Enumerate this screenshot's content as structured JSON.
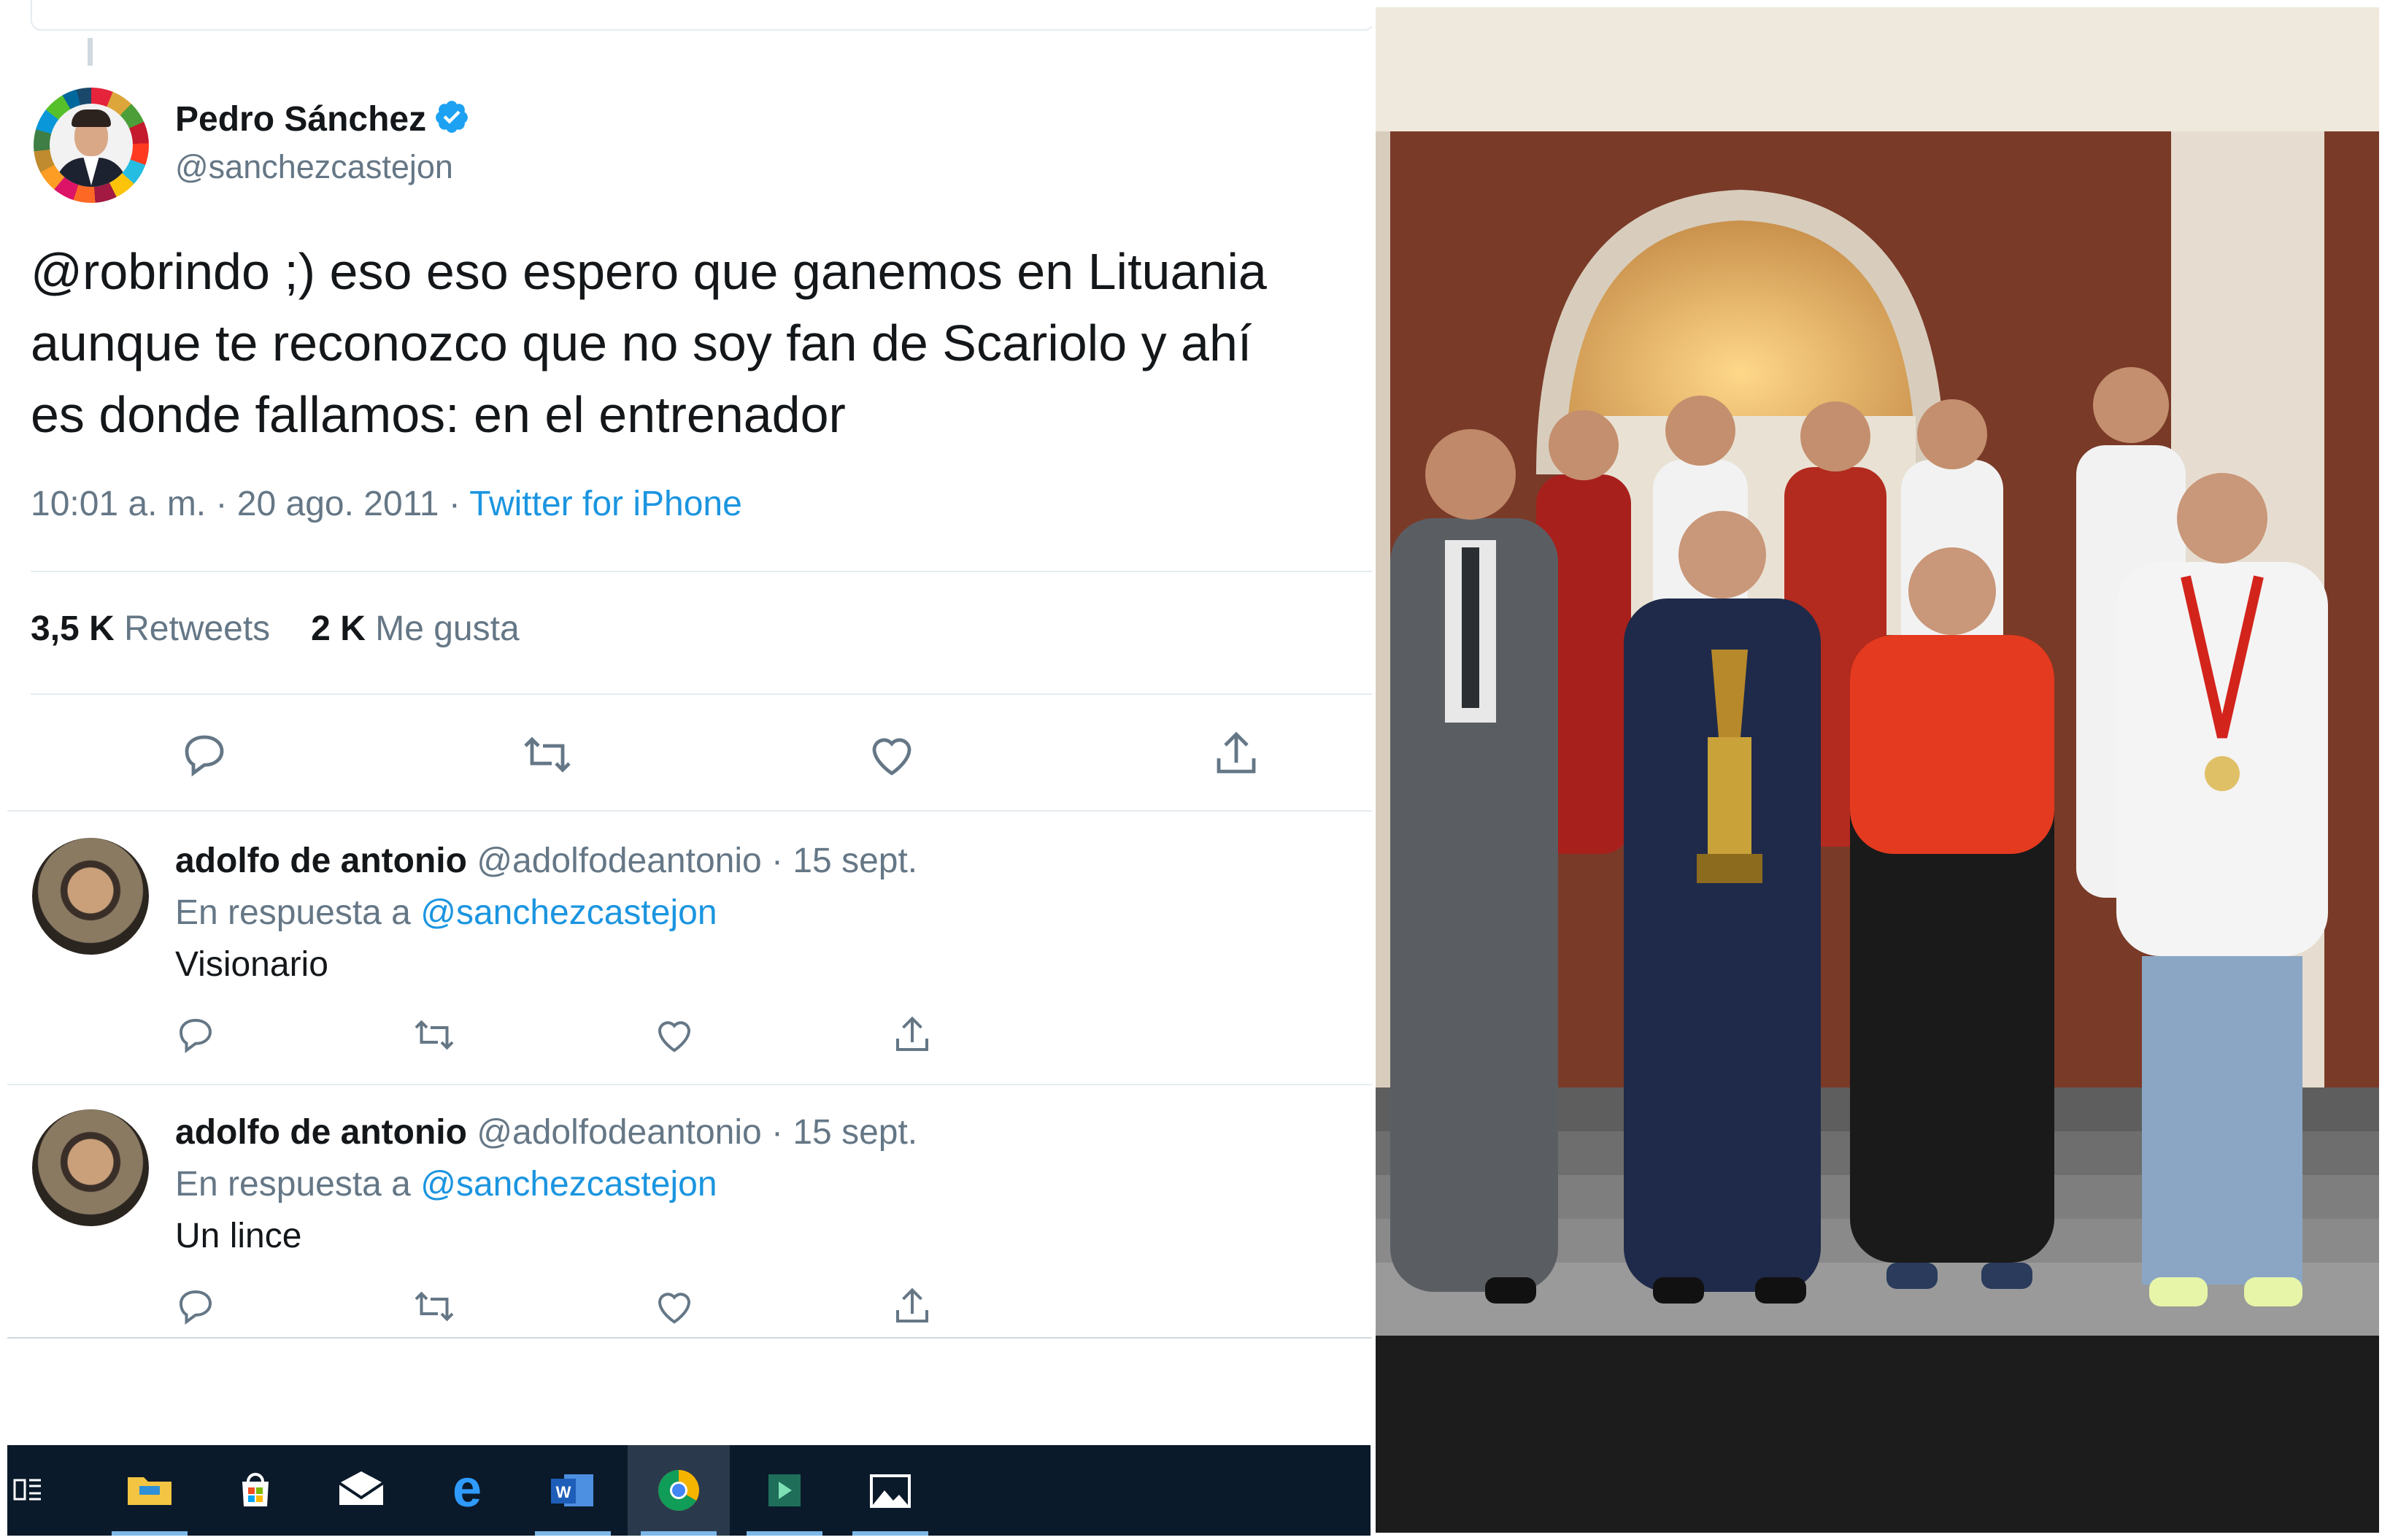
{
  "tweet": {
    "author_name": "Pedro Sánchez",
    "author_handle": "@sanchezcastejon",
    "text": "@robrindo ;) eso eso espero que ganemos en Lituania\naunque te reconozco que no soy fan de Scariolo y ahí\nes donde fallamos: en el entrenador",
    "time": "10:01 a. m. · 20 ago. 2011 · ",
    "source": "Twitter for iPhone",
    "retweets_count": "3,5 K",
    "retweets_label": "Retweets",
    "likes_count": "2 K",
    "likes_label": "Me gusta",
    "actions": [
      "reply-icon",
      "retweet-icon",
      "like-icon",
      "share-icon"
    ]
  },
  "replies": [
    {
      "name": "adolfo de antonio",
      "handle_date": "@adolfodeantonio · 15 sept.",
      "reply_to_prefix": "En respuesta a",
      "reply_to_handle": "@sanchezcastejon",
      "text": "Visionario"
    },
    {
      "name": "adolfo de antonio",
      "handle_date": "@adolfodeantonio · 15 sept.",
      "reply_to_prefix": "En respuesta a",
      "reply_to_handle": "@sanchezcastejon",
      "text": "Un lince"
    }
  ],
  "colors": {
    "link": "#1b95e0",
    "secondary_text": "#657786",
    "primary_text": "#14171a",
    "divider": "#e6ecf0",
    "taskbar": "#0b1a2a"
  },
  "taskbar": {
    "items": [
      "task-view-icon",
      "file-explorer-icon",
      "store-icon",
      "mail-icon",
      "edge-icon",
      "word-icon",
      "chrome-icon",
      "app-icon",
      "photos-icon"
    ],
    "active": "chrome-icon"
  },
  "photo": {
    "subject": "basketball team photo with trophy"
  }
}
